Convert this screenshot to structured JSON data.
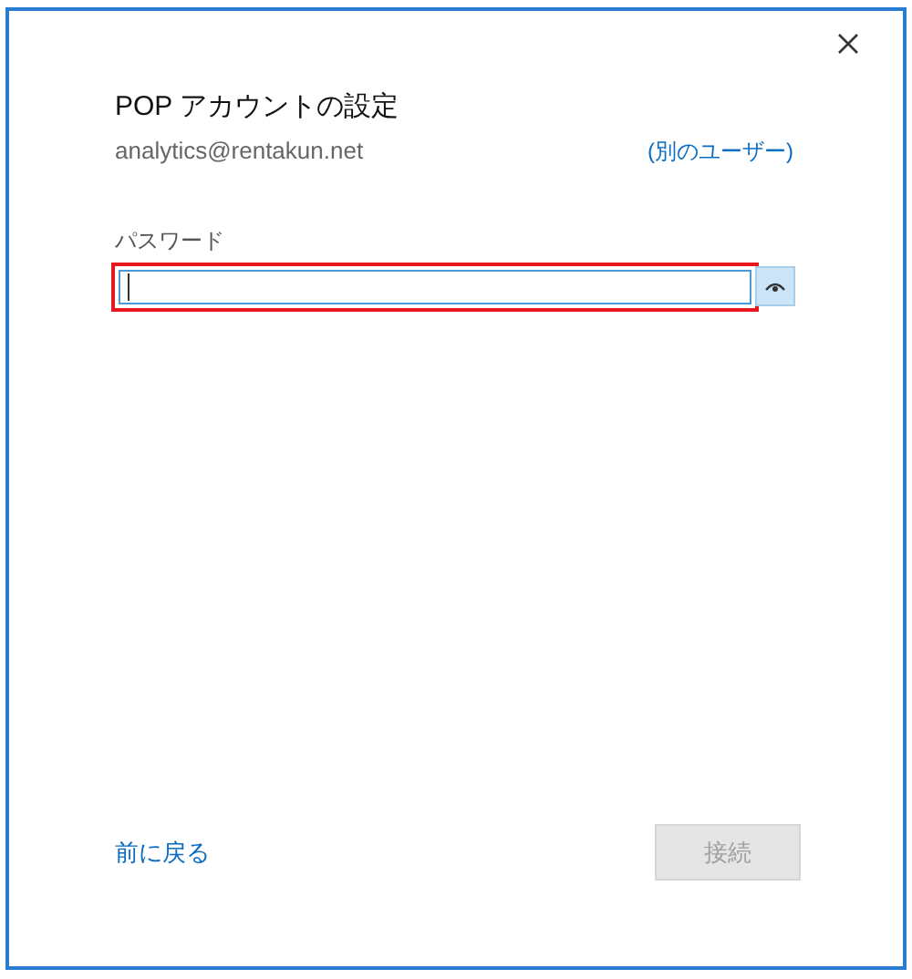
{
  "dialog": {
    "title": "POP アカウントの設定",
    "account": "analytics@rentakun.net",
    "switch_user_link": "(別のユーザー)",
    "password": {
      "label": "パスワード",
      "focused": true,
      "highlighted": true
    },
    "back_link": "前に戻る",
    "connect_button": {
      "label": "接続",
      "disabled": true
    }
  }
}
